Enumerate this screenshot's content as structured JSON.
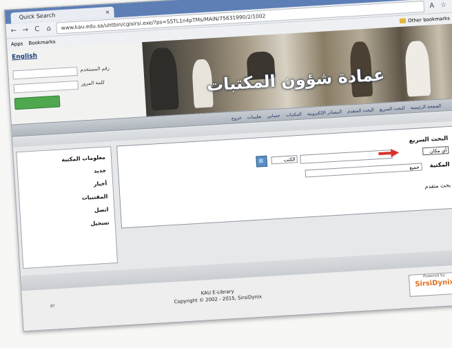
{
  "browser": {
    "tab_title": "Quick Search",
    "url": "www.kau.edu.sa/uhtbin/cgisirsi.exe/?ps=SSTL1n4pTMs/MAIN/75631990/2/1002",
    "bookmarks": [
      "Apps",
      "Bookmarks"
    ],
    "other_bookmarks": "Other bookmarks"
  },
  "login": {
    "english_link": "English",
    "user_label": "رقم المستخدم",
    "pin_label": "كلمة المرور",
    "login_button": ""
  },
  "banner": {
    "title": "عمادة شؤون المكتبات"
  },
  "menu": {
    "items": [
      "الصفحة الرئيسية",
      "البحث السريع",
      "البحث المتقدم",
      "المصادر الإلكترونية",
      "المكتبات",
      "حسابي",
      "تعليمات",
      "خروج"
    ]
  },
  "sidebar": {
    "title": "معلومات المكتبة",
    "items": [
      "جديد",
      "أخبار",
      "المقتنيات",
      "اتصل",
      "تسجيل"
    ]
  },
  "search": {
    "title": "البحث السريع",
    "field_select": "أي مكان",
    "type_select": "الكتب",
    "library_label": "المكتبة",
    "library_select": "جميع",
    "advanced_link": "بحث متقدم"
  },
  "footer": {
    "line1": "KAU E-Library",
    "line2": "Copyright © 2002 - 2015, SirsiDynix",
    "powered_by": "Powered by",
    "vendor_logo": "SirsiDynix",
    "left_text": "ar"
  },
  "colors": {
    "tabstrip": "#5d7fb6",
    "login_button": "#4fa84e",
    "arrow": "#d9332b",
    "go_button": "#5a8fc4"
  }
}
